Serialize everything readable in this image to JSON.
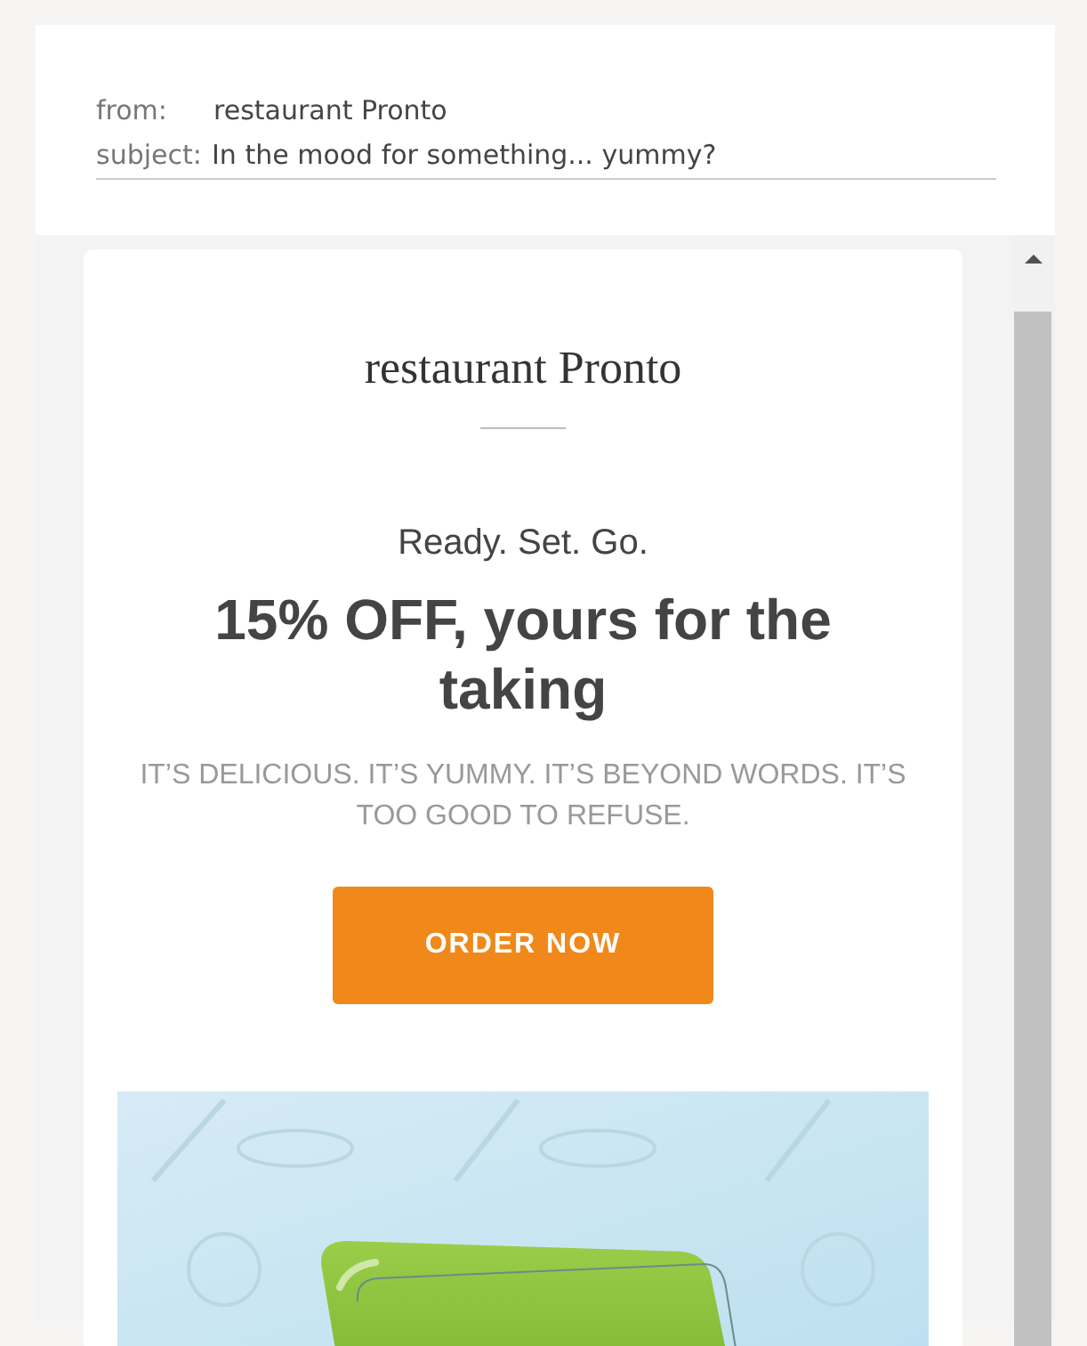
{
  "header": {
    "from_label": "from:",
    "from": "restaurant Pronto",
    "subject_label": "subject:",
    "subject": "In the mood for something... yummy?"
  },
  "email": {
    "brand": "restaurant Pronto",
    "kicker": "Ready. Set. Go.",
    "headline": "15% OFF, yours for the taking",
    "tagline": "IT’S DELICIOUS. IT’S YUMMY. IT’S BEYOND WORDS. IT’S TOO GOOD TO REFUSE.",
    "button": "ORDER NOW"
  }
}
